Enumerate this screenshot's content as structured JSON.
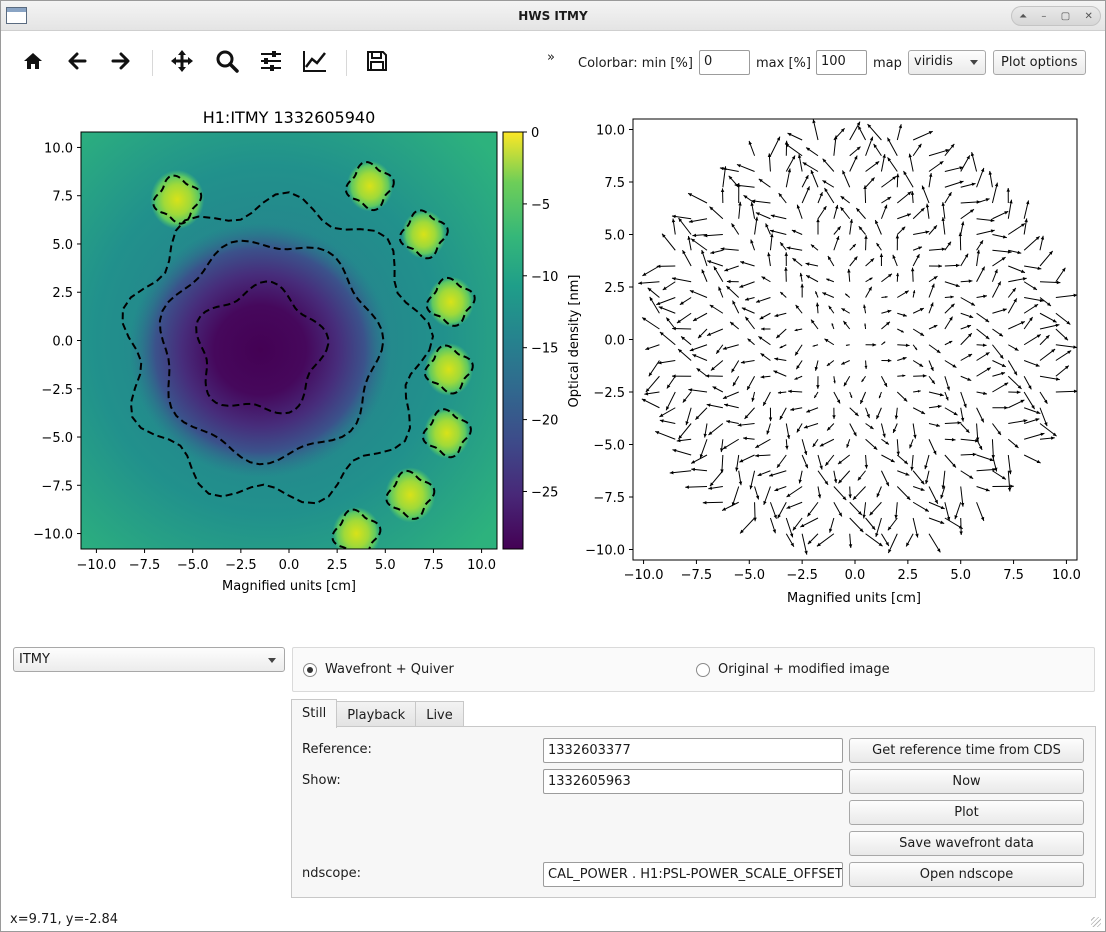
{
  "window": {
    "title": "HWS ITMY",
    "controls": [
      "up-icon",
      "minimize-icon",
      "maximize-icon",
      "close-icon"
    ]
  },
  "toolbar": {
    "buttons": [
      "home-icon",
      "back-icon",
      "forward-icon",
      "pan-icon",
      "zoom-icon",
      "configure-subplots-icon",
      "edit-axis-icon",
      "save-icon"
    ],
    "overflow": "»",
    "colorbar_label": "Colorbar: min [%]",
    "min_value": "0",
    "max_label": "max [%]",
    "max_value": "100",
    "map_label": "map",
    "map_value": "viridis",
    "plot_options": "Plot options"
  },
  "chart_data": [
    {
      "type": "heatmap",
      "title": "H1:ITMY 1332605940",
      "xlabel": "Magnified units [cm]",
      "ylabel": "",
      "xlim": [
        -10.8,
        10.8
      ],
      "ylim": [
        -10.8,
        10.8
      ],
      "xticks": [
        "−10.0",
        "−7.5",
        "−5.0",
        "−2.5",
        "0.0",
        "2.5",
        "5.0",
        "7.5",
        "10.0"
      ],
      "yticks": [
        "10.0",
        "7.5",
        "5.0",
        "2.5",
        "0.0",
        "−2.5",
        "−5.0",
        "−7.5",
        "−10.0"
      ],
      "colormap": "viridis",
      "contours": "dashed black",
      "colorbar": {
        "label": "Optical density [nm]",
        "range": [
          -29,
          0
        ],
        "ticks": [
          "0",
          "−5",
          "−10",
          "−15",
          "−20",
          "−25"
        ]
      },
      "features": [
        {
          "kind": "minimum",
          "x": -1.5,
          "y": -0.5,
          "value": -28
        },
        {
          "kind": "peak",
          "x": 7.0,
          "y": 5.5,
          "value": -2
        },
        {
          "kind": "peak",
          "x": 4.2,
          "y": 8.0,
          "value": -3
        },
        {
          "kind": "peak",
          "x": 8.4,
          "y": 2.0,
          "value": -3
        },
        {
          "kind": "peak",
          "x": 8.3,
          "y": -1.5,
          "value": -4
        },
        {
          "kind": "peak",
          "x": 8.2,
          "y": -4.8,
          "value": -3
        },
        {
          "kind": "peak",
          "x": 6.3,
          "y": -8.0,
          "value": -5
        },
        {
          "kind": "peak",
          "x": 3.5,
          "y": -10.0,
          "value": -4
        },
        {
          "kind": "peak",
          "x": -5.8,
          "y": 7.3,
          "value": -7
        }
      ]
    },
    {
      "type": "scatter",
      "subtype": "quiver",
      "title": "",
      "xlabel": "Magnified units [cm]",
      "ylabel": "",
      "xlim": [
        -10.5,
        10.5
      ],
      "ylim": [
        -10.5,
        10.5
      ],
      "xticks": [
        "−10.0",
        "−7.5",
        "−5.0",
        "−2.5",
        "0.0",
        "2.5",
        "5.0",
        "7.5",
        "10.0"
      ],
      "yticks": [
        "10.0",
        "7.5",
        "5.0",
        "2.5",
        "0.0",
        "−2.5",
        "−5.0",
        "−7.5",
        "−10.0"
      ],
      "grid_spacing": 0.75,
      "aperture_radius": 10.0
    }
  ],
  "controls": {
    "detector": "ITMY",
    "mode_options": [
      "Wavefront + Quiver",
      "Original + modified image"
    ],
    "mode_selected": 0,
    "tabs": [
      "Still",
      "Playback",
      "Live"
    ],
    "active_tab": "Still",
    "reference_label": "Reference:",
    "reference_value": "1332603377",
    "show_label": "Show:",
    "show_value": "1332605963",
    "ndscope_label": "ndscope:",
    "ndscope_value": "CAL_POWER . H1:PSL-POWER_SCALE_OFFSET",
    "btn_reference": "Get reference time from CDS",
    "btn_now": "Now",
    "btn_plot": "Plot",
    "btn_save": "Save wavefront data",
    "btn_ndscope": "Open ndscope"
  },
  "status": {
    "coords": "x=9.71, y=-2.84"
  }
}
